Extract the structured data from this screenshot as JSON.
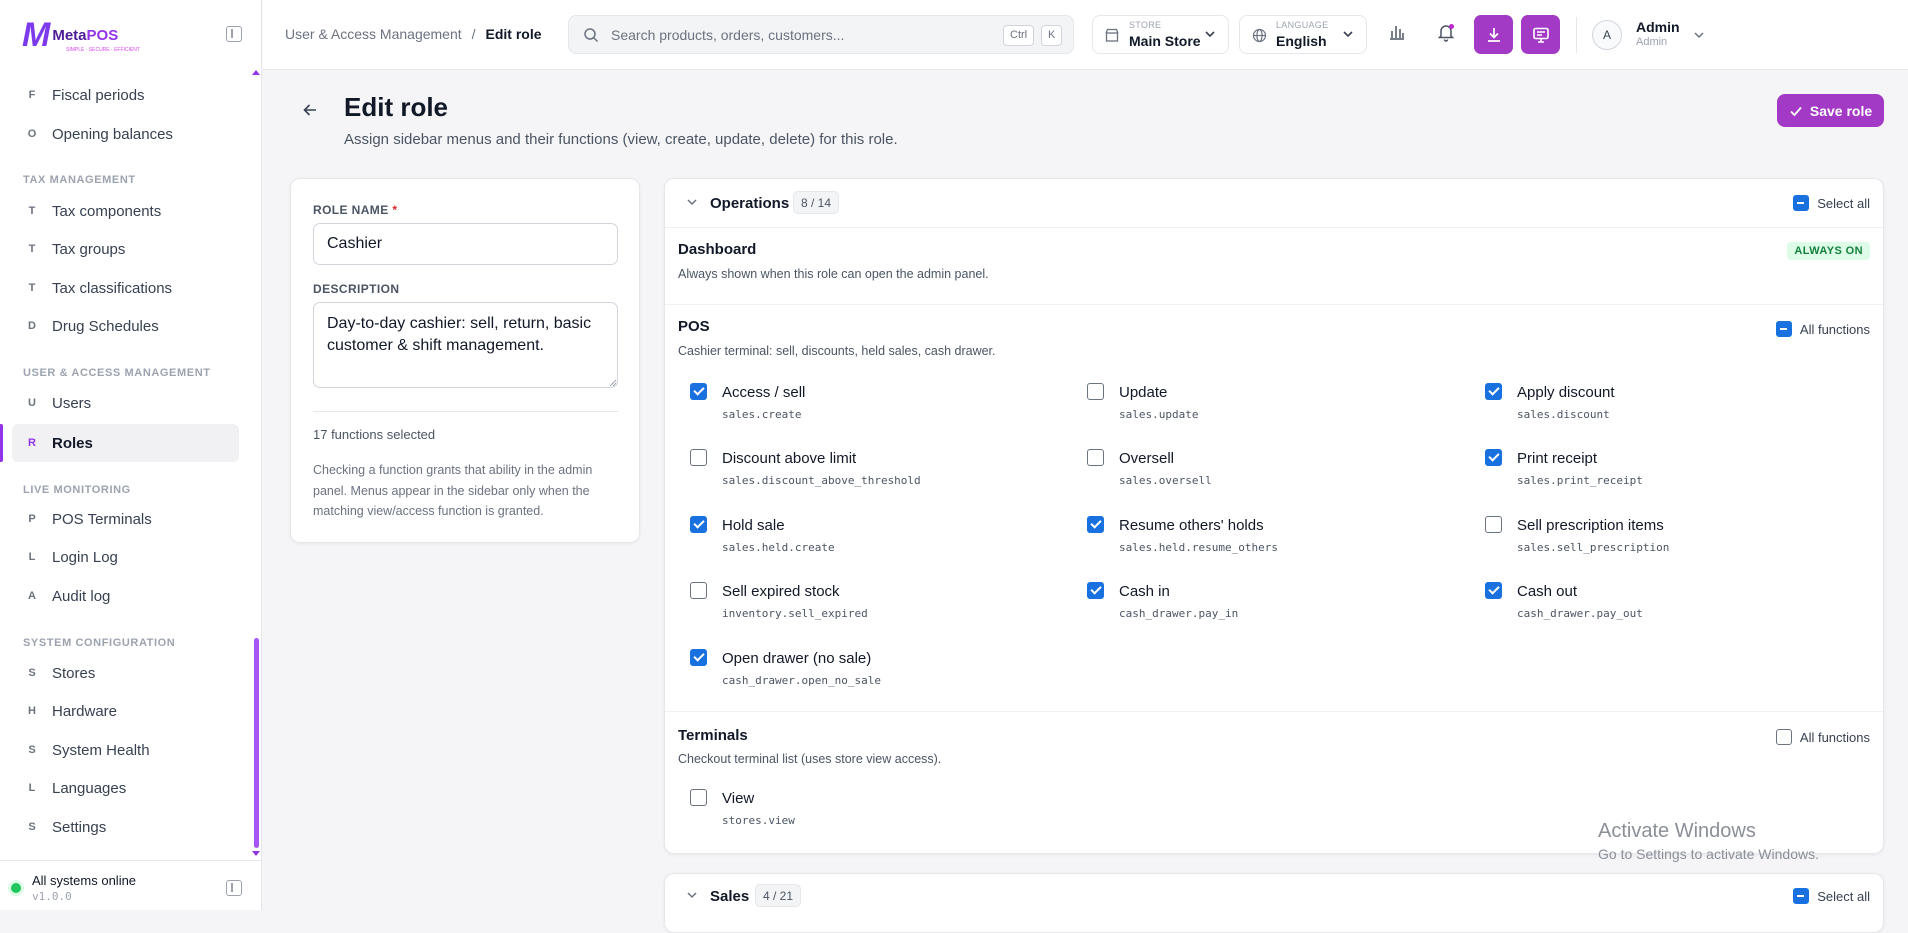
{
  "brand": {
    "logo_letter": "M",
    "name_part1": "Meta",
    "name_part2": "POS",
    "tagline": "SIMPLE · SECURE · EFFICIENT"
  },
  "sidebar": {
    "sections": [
      {
        "label": "TAX MANAGEMENT"
      },
      {
        "label": "USER & ACCESS MANAGEMENT"
      },
      {
        "label": "LIVE MONITORING"
      },
      {
        "label": "SYSTEM CONFIGURATION"
      }
    ],
    "items": [
      {
        "letter": "F",
        "label": "Fiscal periods"
      },
      {
        "letter": "O",
        "label": "Opening balances"
      },
      {
        "letter": "T",
        "label": "Tax components"
      },
      {
        "letter": "T",
        "label": "Tax groups"
      },
      {
        "letter": "T",
        "label": "Tax classifications"
      },
      {
        "letter": "D",
        "label": "Drug Schedules"
      },
      {
        "letter": "U",
        "label": "Users"
      },
      {
        "letter": "R",
        "label": "Roles"
      },
      {
        "letter": "P",
        "label": "POS Terminals"
      },
      {
        "letter": "L",
        "label": "Login Log"
      },
      {
        "letter": "A",
        "label": "Audit log"
      },
      {
        "letter": "S",
        "label": "Stores"
      },
      {
        "letter": "H",
        "label": "Hardware"
      },
      {
        "letter": "S",
        "label": "System Health"
      },
      {
        "letter": "L",
        "label": "Languages"
      },
      {
        "letter": "S",
        "label": "Settings"
      }
    ],
    "active_item": "Roles",
    "footer": {
      "status": "All systems online",
      "version": "v1.0.0"
    }
  },
  "header": {
    "breadcrumb": {
      "parent": "User & Access Management",
      "separator": "/",
      "current": "Edit role"
    },
    "search": {
      "placeholder": "Search products, orders, customers...",
      "kbd1": "Ctrl",
      "kbd2": "K"
    },
    "store": {
      "caption": "STORE",
      "value": "Main Store"
    },
    "language": {
      "caption": "LANGUAGE",
      "value": "English"
    },
    "user": {
      "avatar": "A",
      "name": "Admin",
      "role": "Admin"
    }
  },
  "page": {
    "title": "Edit role",
    "subtitle": "Assign sidebar menus and their functions (view, create, update, delete) for this role.",
    "save_label": "Save role"
  },
  "form": {
    "role_name_label": "ROLE NAME",
    "required_mark": "*",
    "role_name_value": "Cashier",
    "description_label": "DESCRIPTION",
    "description_value": "Day-to-day cashier: sell, return, basic customer & shift management.",
    "selected_count": "17 functions selected",
    "help_text": "Checking a function grants that ability in the admin panel. Menus appear in the sidebar only when the matching view/access function is granted."
  },
  "groups": [
    {
      "title": "Operations",
      "count": "8 / 14",
      "select_all_label": "Select all",
      "sections": [
        {
          "title": "Dashboard",
          "desc": "Always shown when this role can open the admin panel.",
          "badge": "ALWAYS ON"
        },
        {
          "title": "POS",
          "desc": "Cashier terminal: sell, discounts, held sales, cash drawer.",
          "all_label": "All functions",
          "functions": [
            {
              "label": "Access / sell",
              "key": "sales.create",
              "checked": true
            },
            {
              "label": "Update",
              "key": "sales.update",
              "checked": false
            },
            {
              "label": "Apply discount",
              "key": "sales.discount",
              "checked": true
            },
            {
              "label": "Discount above limit",
              "key": "sales.discount_above_threshold",
              "checked": false
            },
            {
              "label": "Oversell",
              "key": "sales.oversell",
              "checked": false
            },
            {
              "label": "Print receipt",
              "key": "sales.print_receipt",
              "checked": true
            },
            {
              "label": "Hold sale",
              "key": "sales.held.create",
              "checked": true
            },
            {
              "label": "Resume others' holds",
              "key": "sales.held.resume_others",
              "checked": true
            },
            {
              "label": "Sell prescription items",
              "key": "sales.sell_prescription",
              "checked": false
            },
            {
              "label": "Sell expired stock",
              "key": "inventory.sell_expired",
              "checked": false
            },
            {
              "label": "Cash in",
              "key": "cash_drawer.pay_in",
              "checked": true
            },
            {
              "label": "Cash out",
              "key": "cash_drawer.pay_out",
              "checked": true
            },
            {
              "label": "Open drawer (no sale)",
              "key": "cash_drawer.open_no_sale",
              "checked": true
            }
          ]
        },
        {
          "title": "Terminals",
          "desc": "Checkout terminal list (uses store view access).",
          "all_label": "All functions",
          "functions": [
            {
              "label": "View",
              "key": "stores.view",
              "checked": false
            }
          ]
        }
      ]
    },
    {
      "title": "Sales",
      "count": "4 / 21",
      "select_all_label": "Select all"
    }
  ],
  "watermark": {
    "line1": "Activate Windows",
    "line2": "Go to Settings to activate Windows."
  },
  "colors": {
    "accent": "#a23ac6",
    "checkbox": "#1971e0",
    "online": "#22c55e",
    "badge_bg": "#dcfce7"
  }
}
